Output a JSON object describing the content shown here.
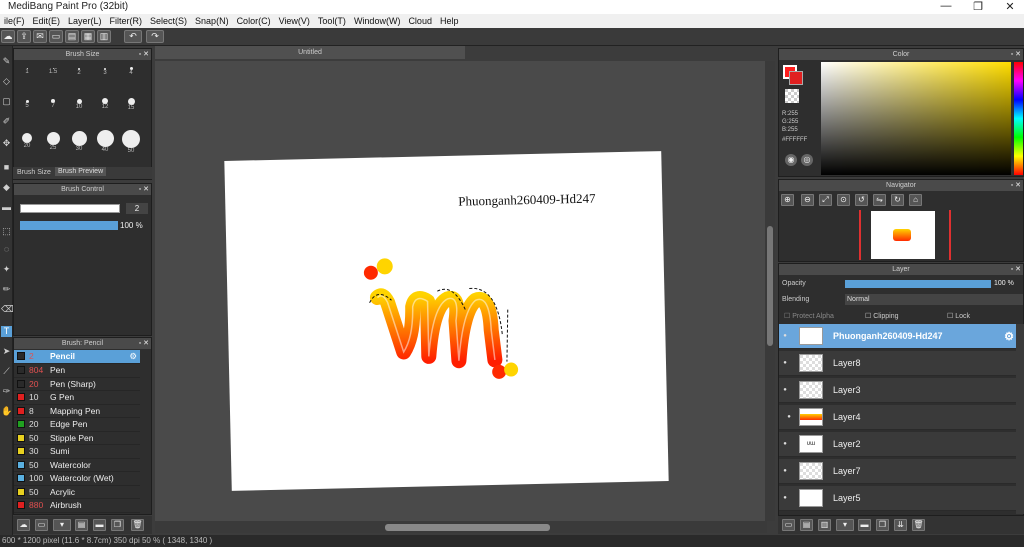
{
  "app": {
    "title": "MediBang Paint Pro (32bit)"
  },
  "window_controls": [
    "—",
    "❐",
    "✕"
  ],
  "menu": [
    "ile(F)",
    "Edit(E)",
    "Layer(L)",
    "Filter(R)",
    "Select(S)",
    "Snap(N)",
    "Color(C)",
    "View(V)",
    "Tool(T)",
    "Window(W)",
    "Cloud",
    "Help"
  ],
  "document": {
    "tab_title": "Untitled",
    "signature_text": "Phuonganh260409-Hd247"
  },
  "brush_size_panel": {
    "title": "Brush Size",
    "sizes": [
      "1",
      "1.5",
      "2",
      "3",
      "4",
      "5",
      "7",
      "10",
      "12",
      "15",
      "20",
      "25",
      "30",
      "40",
      "50"
    ],
    "tabs": [
      "Brush Size",
      "Brush Preview"
    ]
  },
  "brush_control": {
    "title": "Brush Control",
    "size_value": "2",
    "opacity_value": "100 %"
  },
  "brush_panel": {
    "title": "Brush: Pencil",
    "items": [
      {
        "size": "2",
        "name": "Pencil",
        "color": "#2a2a2a",
        "selected": true
      },
      {
        "size": "804",
        "name": "Pen",
        "color": "#2a2a2a"
      },
      {
        "size": "20",
        "name": "Pen (Sharp)",
        "color": "#2a2a2a"
      },
      {
        "size": "10",
        "name": "G Pen",
        "color": "#e02020"
      },
      {
        "size": "8",
        "name": "Mapping Pen",
        "color": "#e02020"
      },
      {
        "size": "20",
        "name": "Edge Pen",
        "color": "#20a020"
      },
      {
        "size": "50",
        "name": "Stipple Pen",
        "color": "#e8d020"
      },
      {
        "size": "30",
        "name": "Sumi",
        "color": "#e8d020"
      },
      {
        "size": "50",
        "name": "Watercolor",
        "color": "#5ab0e0"
      },
      {
        "size": "100",
        "name": "Watercolor (Wet)",
        "color": "#5ab0e0"
      },
      {
        "size": "50",
        "name": "Acrylic",
        "color": "#e8d020"
      },
      {
        "size": "880",
        "name": "Airbrush",
        "color": "#e02020"
      }
    ]
  },
  "color_panel": {
    "title": "Color",
    "r": "R:255",
    "g": "G:255",
    "b": "B:255",
    "hex": "#FFFFFF"
  },
  "navigator": {
    "title": "Navigator"
  },
  "layer_panel": {
    "title": "Layer",
    "opacity_label": "Opacity",
    "opacity_value": "100 %",
    "blending_label": "Blending",
    "blending_value": "Normal",
    "protect_alpha": "Protect Alpha",
    "clipping": "Clipping",
    "lock": "Lock",
    "layers": [
      "Phuonganh260409-Hd247",
      "Layer8",
      "Layer3",
      "Layer4",
      "Layer2",
      "Layer7",
      "Layer5"
    ]
  },
  "status": {
    "text": "600 * 1200 pixel   (11.6 * 8.7cm)   350 dpi   50 %   ( 1348, 1340 )"
  }
}
